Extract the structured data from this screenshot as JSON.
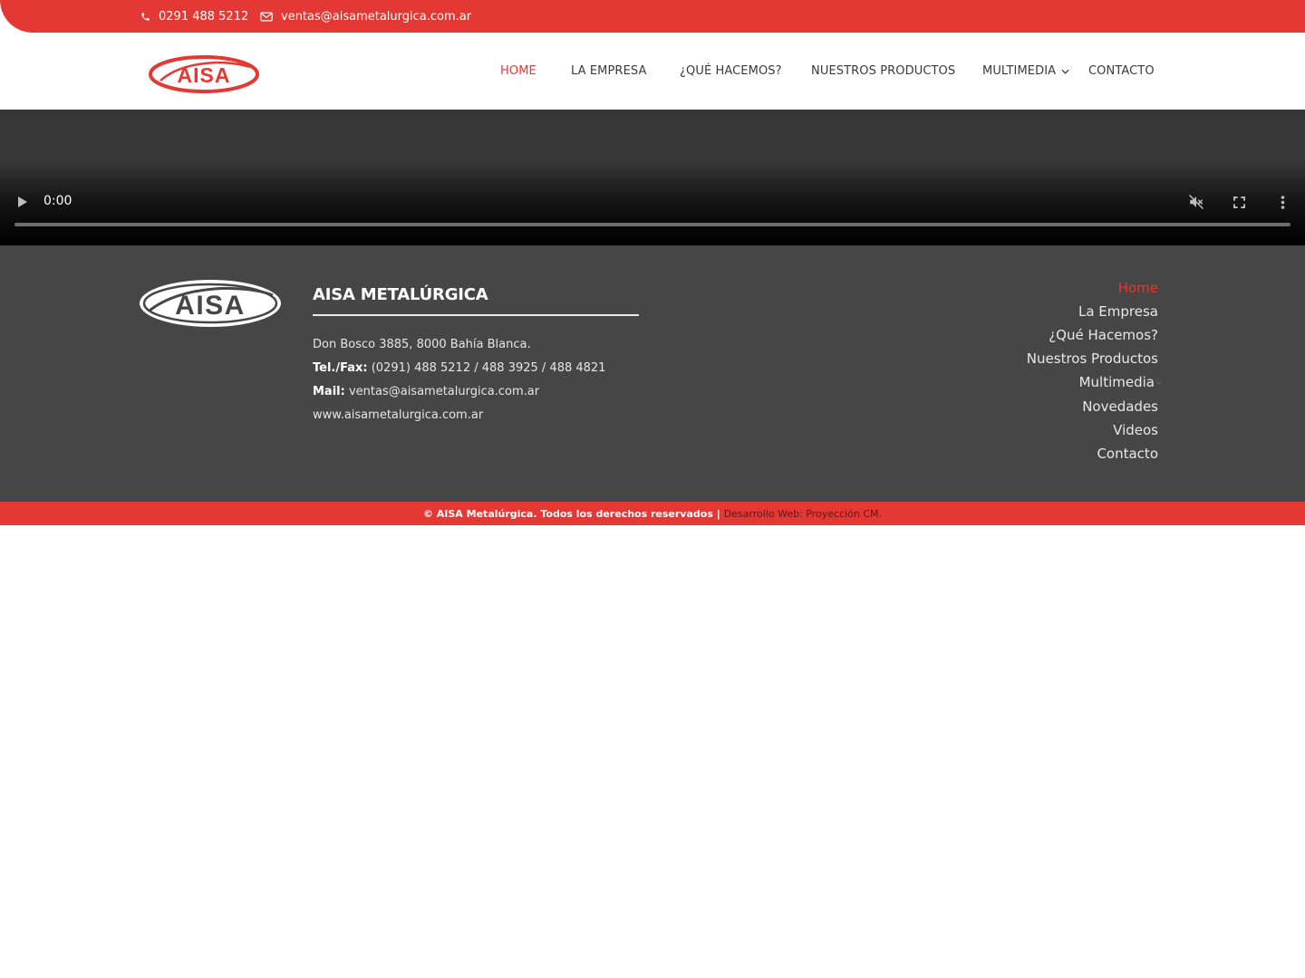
{
  "topbar": {
    "phone": "0291 488 5212",
    "email": "ventas@aisametalurgica.com.ar",
    "phone_icon": "phone-icon",
    "email_icon": "envelope-icon"
  },
  "brand": {
    "logo_text": "AISA",
    "accent": "#e43834"
  },
  "nav": {
    "items": [
      {
        "label": "HOME"
      },
      {
        "label": "LA EMPRESA"
      },
      {
        "label": "¿QUÉ HACEMOS?"
      },
      {
        "label": "NUESTROS PRODUCTOS"
      },
      {
        "label": "MULTIMEDIA"
      },
      {
        "label": "CONTACTO"
      }
    ],
    "active": "HOME"
  },
  "video": {
    "time": "0:00",
    "progress": 0,
    "icons": [
      "play-icon",
      "muted-volume-icon",
      "fullscreen-icon",
      "more-options-icon"
    ]
  },
  "footer": {
    "logo_text": "AISA",
    "title": "AISA METALÚRGICA",
    "address": "Don Bosco 3885, 8000 Bahía Blanca.",
    "tel_label": "Tel./Fax:",
    "tel_value": " (0291) 488 5212 / 488 3925 / 488 4821",
    "mail_label": "Mail:",
    "mail_value": " ventas@aisametalurgica.com.ar",
    "website": "www.aisametalurgica.com.ar",
    "menu": [
      {
        "label": "Home"
      },
      {
        "label": "La Empresa"
      },
      {
        "label": "¿Qué Hacemos?"
      },
      {
        "label": "Nuestros Productos"
      },
      {
        "label": "Multimedia"
      },
      {
        "label": "Novedades"
      },
      {
        "label": "Videos"
      },
      {
        "label": "Contacto"
      }
    ],
    "menu_active": "Home"
  },
  "copyright": {
    "text": "© AISA Metalúrgica. Todos los derechos reservados |",
    "link": "Desarrollo Web: Proyección CM."
  }
}
